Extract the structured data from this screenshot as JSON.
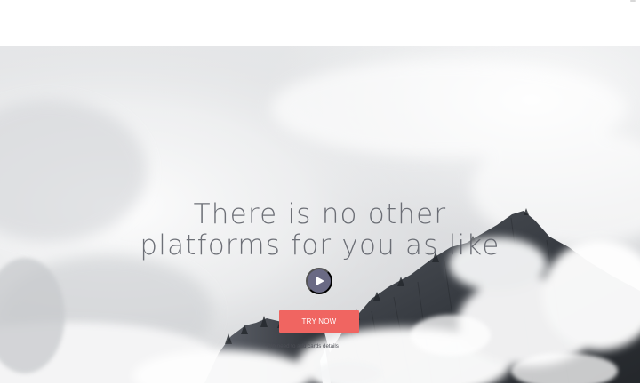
{
  "hero": {
    "headline_line1": "There is no other",
    "headline_line2": "platforms for you as like",
    "cta_label": "TRY NOW",
    "footnote": "* No need to add cards details"
  },
  "colors": {
    "cta_background": "#f06561",
    "play_button": "#6a6a84",
    "headline_text": "#5b5e66"
  },
  "icons": {
    "play": "play-icon"
  }
}
